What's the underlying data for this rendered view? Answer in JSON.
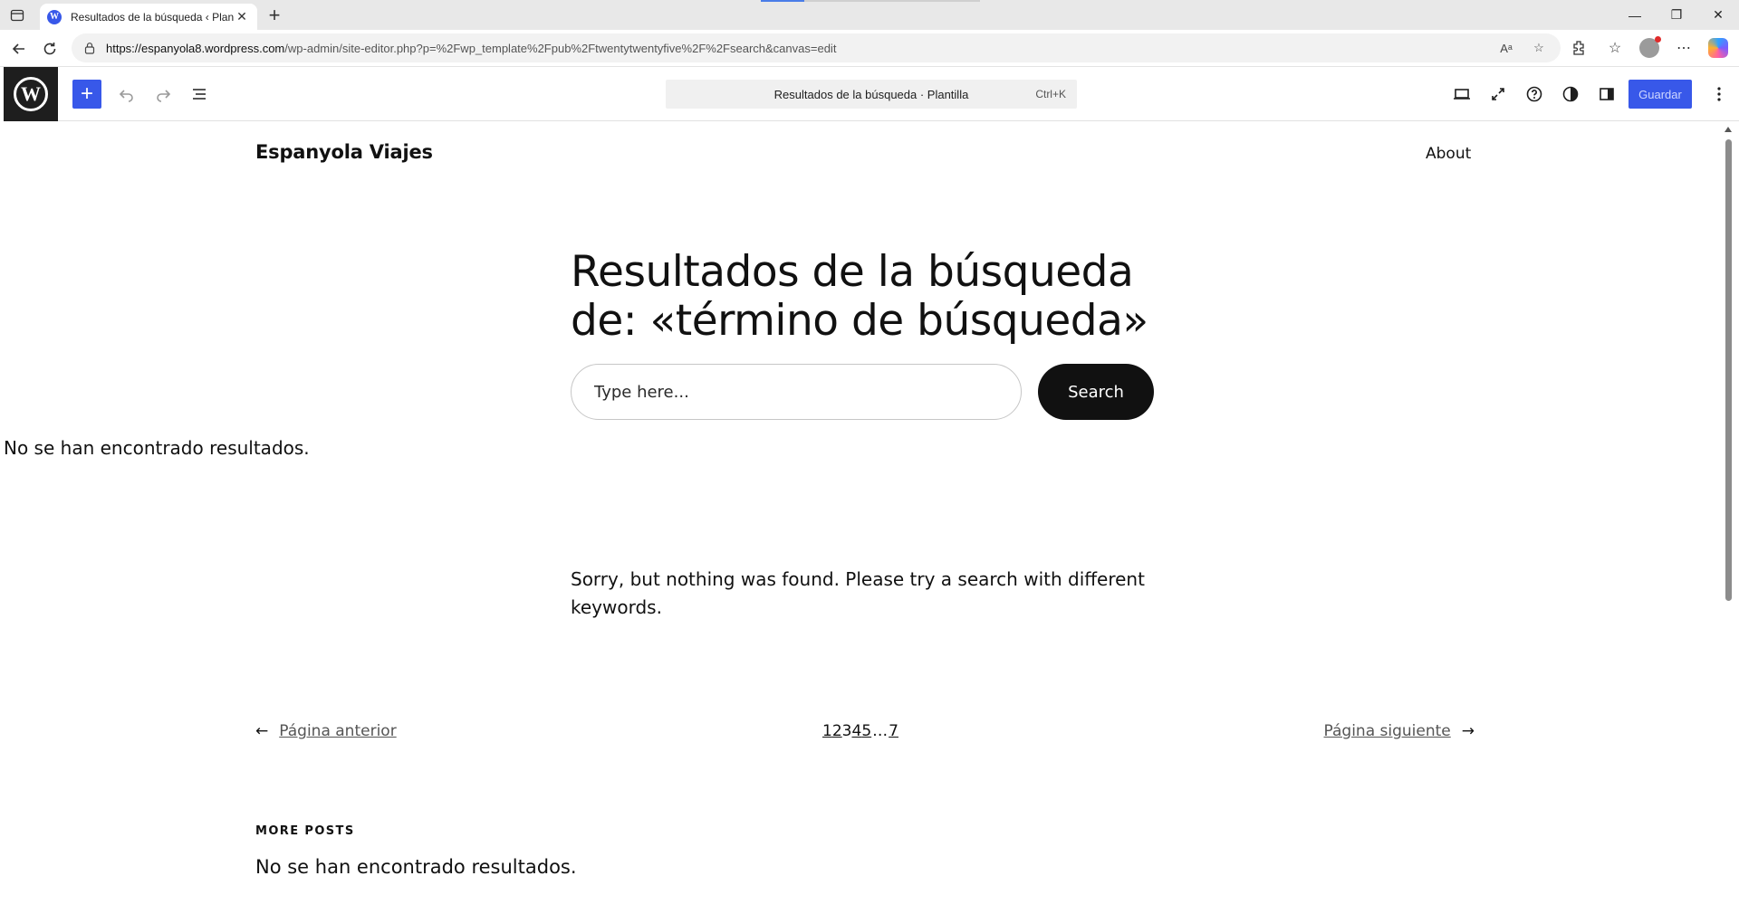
{
  "browser": {
    "tab_title": "Resultados de la búsqueda ‹ Plant",
    "url_host": "https://espanyola8.wordpress.com",
    "url_path": "/wp-admin/site-editor.php?p=%2Fwp_template%2Fpub%2Ftwentytwentyfive%2F%2Fsearch&canvas=edit",
    "new_tab_label": "+"
  },
  "editor": {
    "document_title": "Resultados de la búsqueda · Plantilla",
    "shortcut": "Ctrl+K",
    "save_label": "Guardar",
    "inserter_label": "+"
  },
  "site": {
    "title": "Espanyola Viajes",
    "nav_about": "About"
  },
  "main": {
    "heading": "Resultados de la búsqueda de: «término de búsqueda»",
    "search_placeholder": "Type here...",
    "search_button": "Search",
    "no_results": "No se han encontrado resultados.",
    "sorry_text": "Sorry, but nothing was found. Please try a search with different keywords."
  },
  "pagination": {
    "prev_arrow": "←",
    "prev_label": "Página anterior",
    "next_label": "Página siguiente",
    "next_arrow": "→",
    "pages": [
      "1",
      "2",
      "3",
      "4",
      "5",
      "…",
      "7"
    ]
  },
  "more_posts": {
    "heading": "MORE POSTS",
    "no_results": "No se han encontrado resultados."
  },
  "colors": {
    "wp_blue": "#3858e9",
    "dark": "#1e1e1e",
    "button_black": "#111111"
  }
}
